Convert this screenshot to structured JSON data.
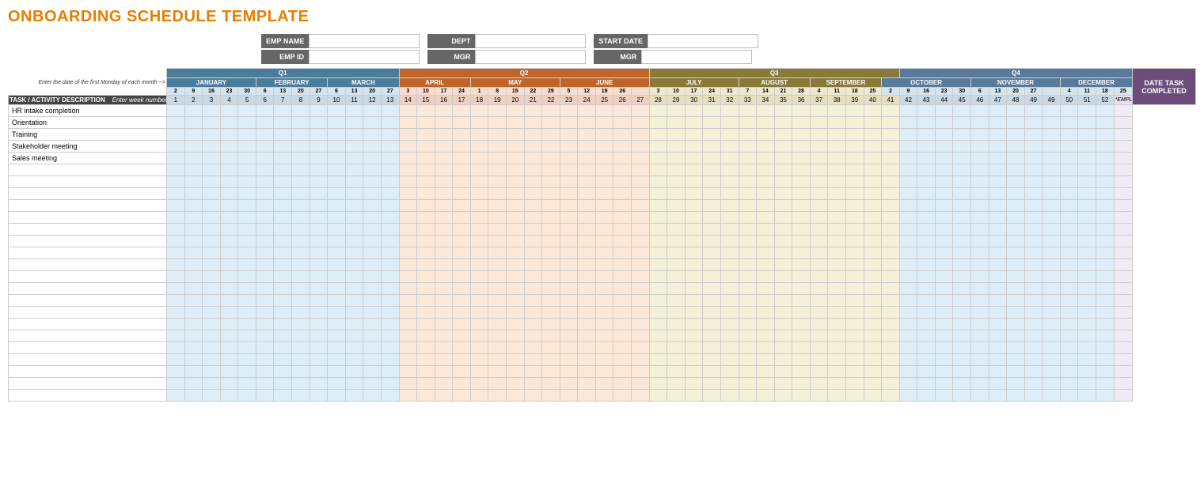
{
  "title": "ONBOARDING SCHEDULE TEMPLATE",
  "form": {
    "emp_name_label": "EMP NAME",
    "emp_id_label": "EMP ID",
    "dept_label": "DEPT",
    "mgr_label": "MGR",
    "start_date_label": "START DATE",
    "mgr2_label": "MGR"
  },
  "quarters": [
    {
      "label": "Q1",
      "class": "q1-header",
      "colspan": 13
    },
    {
      "label": "Q2",
      "class": "q2-header",
      "colspan": 14
    },
    {
      "label": "Q3",
      "class": "q3-header",
      "colspan": 14
    },
    {
      "label": "Q4",
      "class": "q4-header",
      "colspan": 13
    }
  ],
  "months": [
    {
      "label": "JANUARY",
      "class": "month-jan",
      "colspan": 5,
      "q": 1
    },
    {
      "label": "FEBRUARY",
      "class": "month-feb",
      "colspan": 4,
      "q": 1
    },
    {
      "label": "MARCH",
      "class": "month-mar",
      "colspan": 4,
      "q": 1
    },
    {
      "label": "APRIL",
      "class": "month-apr",
      "colspan": 4,
      "q": 2
    },
    {
      "label": "MAY",
      "class": "month-may",
      "colspan": 5,
      "q": 2
    },
    {
      "label": "JUNE",
      "class": "month-jun",
      "colspan": 5,
      "q": 2
    },
    {
      "label": "JULY",
      "class": "month-jul",
      "colspan": 5,
      "q": 3
    },
    {
      "label": "AUGUST",
      "class": "month-aug",
      "colspan": 5,
      "q": 3
    },
    {
      "label": "SEPTEMBER",
      "class": "month-sep",
      "colspan": 4,
      "q": 3
    },
    {
      "label": "OCTOBER",
      "class": "month-oct",
      "colspan": 5,
      "q": 4
    },
    {
      "label": "NOVEMBER",
      "class": "month-nov",
      "colspan": 5,
      "q": 4
    },
    {
      "label": "DECEMBER",
      "class": "month-dec",
      "colspan": 4,
      "q": 4
    }
  ],
  "month_dates": {
    "january": [
      "2",
      "9",
      "16",
      "23",
      "30"
    ],
    "february": [
      "6",
      "13",
      "20",
      "27"
    ],
    "march": [
      "6",
      "13",
      "20",
      "27"
    ],
    "april": [
      "3",
      "10",
      "17",
      "24"
    ],
    "may": [
      "1",
      "8",
      "15",
      "22",
      "29"
    ],
    "june": [
      "5",
      "12",
      "19",
      "26"
    ],
    "july": [
      "3",
      "10",
      "17",
      "24",
      "31"
    ],
    "august": [
      "7",
      "14",
      "21",
      "28"
    ],
    "september": [
      "4",
      "11",
      "18",
      "25"
    ],
    "october": [
      "2",
      "9",
      "16",
      "23",
      "30"
    ],
    "november": [
      "6",
      "13",
      "20",
      "27"
    ],
    "december": [
      "4",
      "11",
      "18",
      "25"
    ]
  },
  "week_numbers": {
    "q1": [
      "1",
      "2",
      "3",
      "4",
      "5",
      "6",
      "7",
      "8",
      "9",
      "10",
      "11",
      "12",
      "13"
    ],
    "q2": [
      "14",
      "15",
      "16",
      "17",
      "18",
      "19",
      "20",
      "21",
      "22",
      "23",
      "24",
      "25",
      "26",
      "27"
    ],
    "q3": [
      "28",
      "29",
      "30",
      "31",
      "32",
      "33",
      "34",
      "35",
      "36",
      "37",
      "38",
      "39",
      "40",
      "41"
    ],
    "q4": [
      "41",
      "42",
      "43",
      "44",
      "45",
      "46",
      "47",
      "48",
      "49",
      "49",
      "50",
      "51",
      "52"
    ]
  },
  "task_header": "TASK / ACTIVITY DESCRIPTION",
  "week_enter_label": "Enter week number -->",
  "enter_date_hint": "Enter the date of the first Monday of each month -->",
  "date_task_completed": "DATE TASK COMPLETED",
  "employee_enter": "*EMPLOYEE TO ENTER",
  "tasks": [
    "HR intake completion",
    "Orientation",
    "Training",
    "Stakeholder meeting",
    "Sales meeting",
    "",
    "",
    "",
    "",
    "",
    "",
    "",
    "",
    "",
    "",
    "",
    "",
    "",
    "",
    "",
    "",
    "",
    "",
    "",
    ""
  ]
}
